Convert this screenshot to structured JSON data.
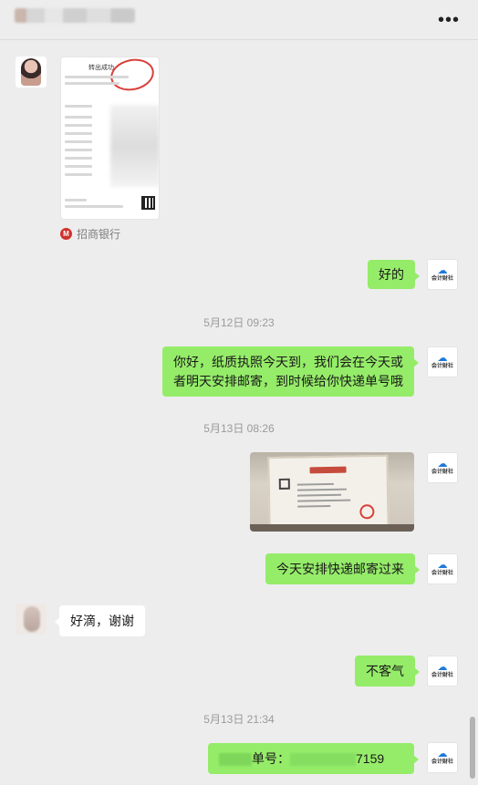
{
  "header": {
    "more_glyph": "•••"
  },
  "messages": {
    "bank_label": "招商银行",
    "m1": "好的",
    "t1": "5月12日 09:23",
    "m2_line1": "你好，纸质执照今天到，我们会在今天或",
    "m2_line2": "者明天安排邮寄，到时候给你快递单号哦",
    "t2": "5月13日 08:26",
    "m3": "今天安排快递邮寄过来",
    "m4": "好滴，谢谢",
    "m5": "不客气",
    "t3": "5月13日 21:34",
    "m6_prefix": "单号：",
    "m6_suffix": "7159"
  },
  "receipt": {
    "title": "转出成功"
  },
  "icons": {
    "brand_cloud": "☁",
    "brand_text": "会计财社"
  },
  "colors": {
    "self_bubble": "#95ec69",
    "peer_bubble": "#ffffff",
    "background": "#ededed"
  }
}
